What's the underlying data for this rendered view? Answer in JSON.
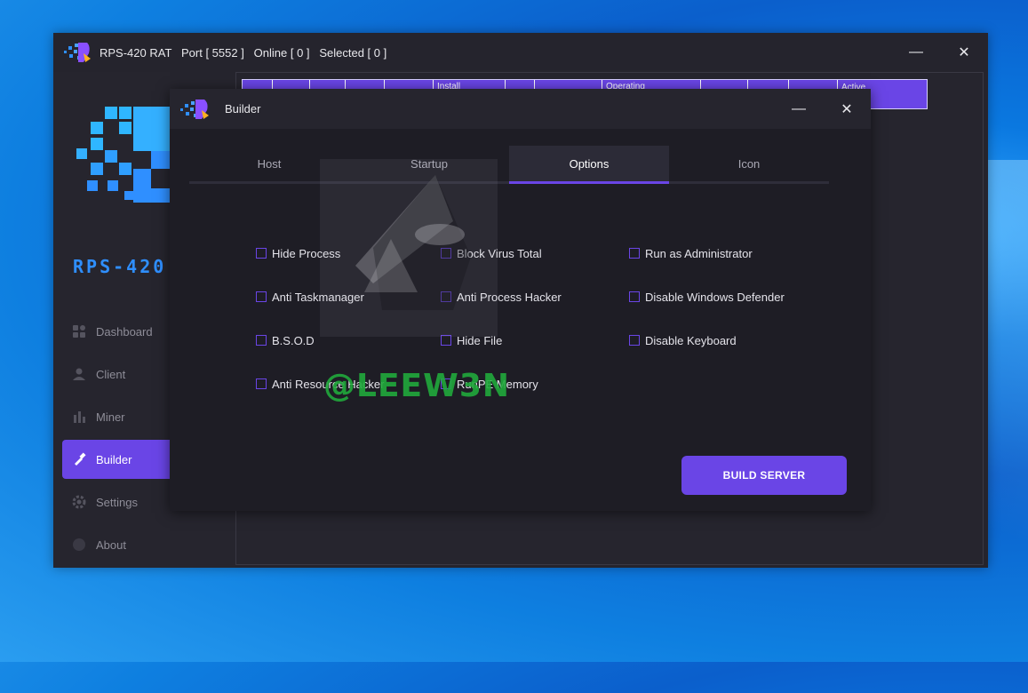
{
  "main_window": {
    "title": "RPS-420 RAT   Port [ 5552 ]   Online [ 0 ]   Selected [ 0 ]",
    "controls": {
      "minimize": "—",
      "close": "✕"
    }
  },
  "sidebar": {
    "brand": "RPS-420",
    "items": [
      {
        "label": "Dashboard",
        "icon": "dashboard-icon"
      },
      {
        "label": "Client",
        "icon": "client-icon"
      },
      {
        "label": "Miner",
        "icon": "miner-icon"
      },
      {
        "label": "Builder",
        "icon": "builder-icon",
        "active": true
      },
      {
        "label": "Settings",
        "icon": "settings-icon"
      },
      {
        "label": "About",
        "icon": "about-icon"
      }
    ]
  },
  "table": {
    "headers": [
      "",
      "",
      "",
      "",
      "",
      "Install",
      "",
      "",
      "Operating",
      "",
      "",
      "",
      "Active\now"
    ]
  },
  "builder": {
    "title": "Builder",
    "controls": {
      "minimize": "—",
      "close": "✕"
    },
    "tabs": [
      "Host",
      "Startup",
      "Options",
      "Icon"
    ],
    "active_tab": "Options",
    "options": {
      "col1": [
        "Hide Process",
        "Anti Taskmanager",
        "B.S.O.D",
        "Anti Resource Hacker"
      ],
      "col2": [
        "Block Virus Total",
        "Anti Process Hacker",
        "Hide File",
        "RunPE Memory"
      ],
      "col3": [
        "Run as Administrator",
        "Disable Windows Defender",
        "Disable Keyboard"
      ]
    },
    "build_button": "BUILD SERVER"
  },
  "watermark": {
    "text": "@LEEW3N"
  },
  "colors": {
    "accent": "#6a45e6",
    "window_bg": "#25242d",
    "dialog_body": "#1e1d25",
    "brand": "#2f8fff"
  }
}
